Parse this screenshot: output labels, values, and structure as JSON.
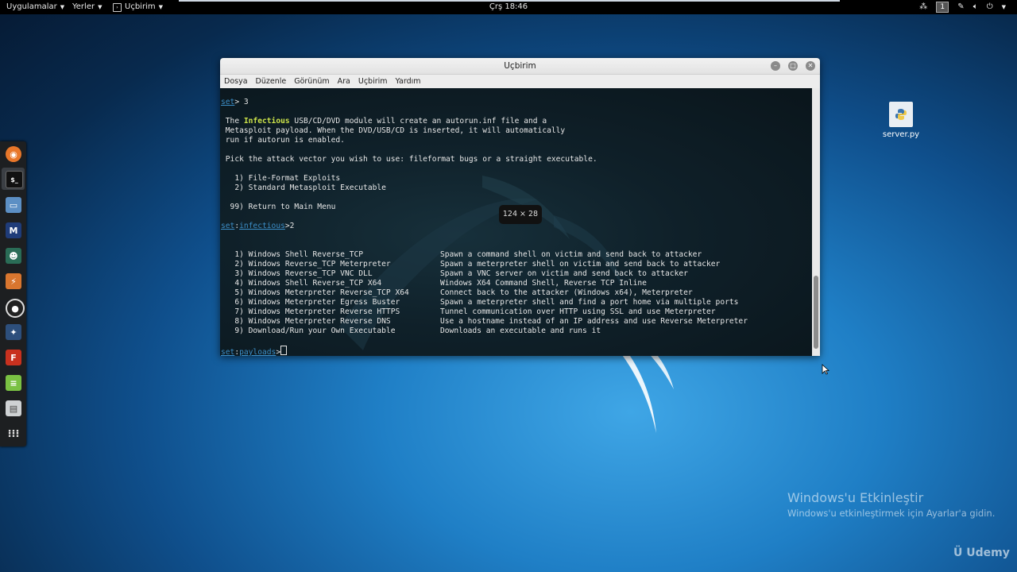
{
  "topbar": {
    "applications": "Uygulamalar",
    "places": "Yerler",
    "terminal_app": "Uçbirim",
    "clock": "Çrş 18:46",
    "workspace": "1"
  },
  "dock": {
    "items": [
      "firefox-icon",
      "terminal-icon",
      "files-icon",
      "metasploit-icon",
      "armitage-icon",
      "burpsuite-icon",
      "maltego-icon",
      "beef-icon",
      "faraday-icon",
      "notes-icon",
      "settings-icon",
      "app-grid-icon"
    ]
  },
  "desktop": {
    "file_icon_label": "server.py",
    "activation_title": "Windows'u Etkinleştir",
    "activation_sub": "Windows'u etkinleştirmek için Ayarlar'a gidin.",
    "udemy": "Udemy"
  },
  "window": {
    "title": "Uçbirim",
    "menu": [
      "Dosya",
      "Düzenle",
      "Görünüm",
      "Ara",
      "Uçbirim",
      "Yardım"
    ],
    "size_tip": "124 × 28"
  },
  "terminal": {
    "prompt_set": "set",
    "line_set3": "> 3",
    "intro_pre": " The ",
    "intro_hl": "Infectious",
    "intro_post": " USB/CD/DVD module will create an autorun.inf file and a",
    "intro_2": " Metasploit payload. When the DVD/USB/CD is inserted, it will automatically",
    "intro_3": " run if autorun is enabled.",
    "pick": " Pick the attack vector you wish to use: fileformat bugs or a straight executable.",
    "opt1": "   1) File-Format Exploits",
    "opt2": "   2) Standard Metasploit Executable",
    "opt99": "  99) Return to Main Menu",
    "prompt_infectious": "infectious",
    "line_infectious": ">2",
    "payloads": [
      {
        "name": "   1) Windows Shell Reverse_TCP",
        "desc": "Spawn a command shell on victim and send back to attacker"
      },
      {
        "name": "   2) Windows Reverse_TCP Meterpreter",
        "desc": "Spawn a meterpreter shell on victim and send back to attacker"
      },
      {
        "name": "   3) Windows Reverse_TCP VNC DLL",
        "desc": "Spawn a VNC server on victim and send back to attacker"
      },
      {
        "name": "   4) Windows Shell Reverse_TCP X64",
        "desc": "Windows X64 Command Shell, Reverse TCP Inline"
      },
      {
        "name": "   5) Windows Meterpreter Reverse_TCP X64",
        "desc": "Connect back to the attacker (Windows x64), Meterpreter"
      },
      {
        "name": "   6) Windows Meterpreter Egress Buster",
        "desc": "Spawn a meterpreter shell and find a port home via multiple ports"
      },
      {
        "name": "   7) Windows Meterpreter Reverse HTTPS",
        "desc": "Tunnel communication over HTTP using SSL and use Meterpreter"
      },
      {
        "name": "   8) Windows Meterpreter Reverse DNS",
        "desc": "Use a hostname instead of an IP address and use Reverse Meterpreter"
      },
      {
        "name": "   9) Download/Run your Own Executable",
        "desc": "Downloads an executable and runs it"
      }
    ],
    "prompt_payloads": "payloads",
    "line_payloads": ">"
  },
  "colors": {
    "prompt": "#3c8fc9",
    "highlight": "#cde34a",
    "terminal_bg": "#0f2029"
  }
}
